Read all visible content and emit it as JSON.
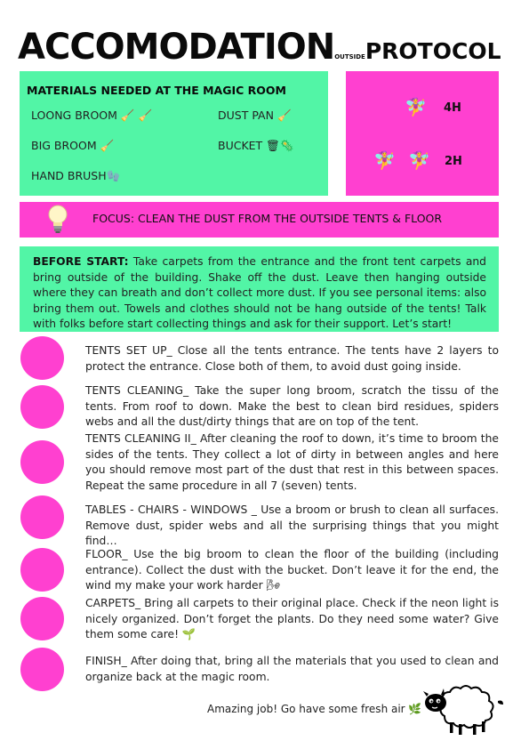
{
  "title": {
    "part1": "ACCOMODATION",
    "part2": "OUTSIDE",
    "part3": "PROTOCOL"
  },
  "materials": {
    "heading": "MATERIALS NEEDED AT THE MAGIC ROOM",
    "items": [
      {
        "label": "LOONG BROOM",
        "emoji": "🧹 🧹"
      },
      {
        "label": "DUST PAN",
        "emoji": "🧹"
      },
      {
        "label": "BIG BROOM",
        "emoji": "🧹"
      },
      {
        "label": "BUCKET",
        "emoji": "🗑🦠"
      },
      {
        "label": "HAND BRUSH",
        "emoji": "🧤"
      }
    ]
  },
  "time": {
    "one_person": "4H",
    "two_people": "2H",
    "person_icon": "🧚‍♀️"
  },
  "focus": {
    "icon": "lightbulb-icon",
    "text": "FOCUS: CLEAN THE DUST FROM THE OUTSIDE TENTS & FLOOR"
  },
  "before_start": {
    "label": "BEFORE START:",
    "text": " Take carpets from the entrance and the front tent carpets and bring outside of the building. Shake off the dust. Leave then hanging outside where they can breath and don’t collect more dust.  If you see personal items: also bring them out. Towels and clothes should not be hang outside of the tents! Talk with folks before start collecting things and ask for their support. Let’s start!"
  },
  "steps": [
    "TENTS SET UP_ Close all the tents entrance. The tents have 2 layers to protect the entrance. Close both of them, to avoid dust going inside.",
    "TENTS CLEANING_  Take the super long broom, scratch the tissu of the tents. From roof to down. Make the best to clean bird residues, spiders webs and all the dust/dirty things that are on top of the tent.",
    "TENTS CLEANING II_ After cleaning the roof to down, it’s time to broom the sides of the tents. They collect a lot of dirty in between angles and here you should remove most part of the dust that rest in this between spaces. Repeat the same procedure in all 7 (seven) tents.",
    "TABLES - CHAIRS - WINDOWS _ Use a broom or brush to clean all surfaces. Remove dust, spider webs and all the surprising things that you might find…",
    "FLOOR_ Use the big broom to clean the floor of the building (including entrance). Collect the dust with the bucket. Don’t leave it for the end, the wind my make your work harder 🌬",
    "CARPETS_ Bring all carpets to their original place. Check if the neon light is nicely organized. Don’t forget the plants. Do they need some water? Give them some care! 🌱",
    "FINISH_ After doing that, bring all the materials that you used to clean and organize back at the magic room."
  ],
  "closing": "Amazing job! Go have some fresh air 🌿",
  "colors": {
    "green": "#52f5a6",
    "pink": "#ff40d0"
  }
}
